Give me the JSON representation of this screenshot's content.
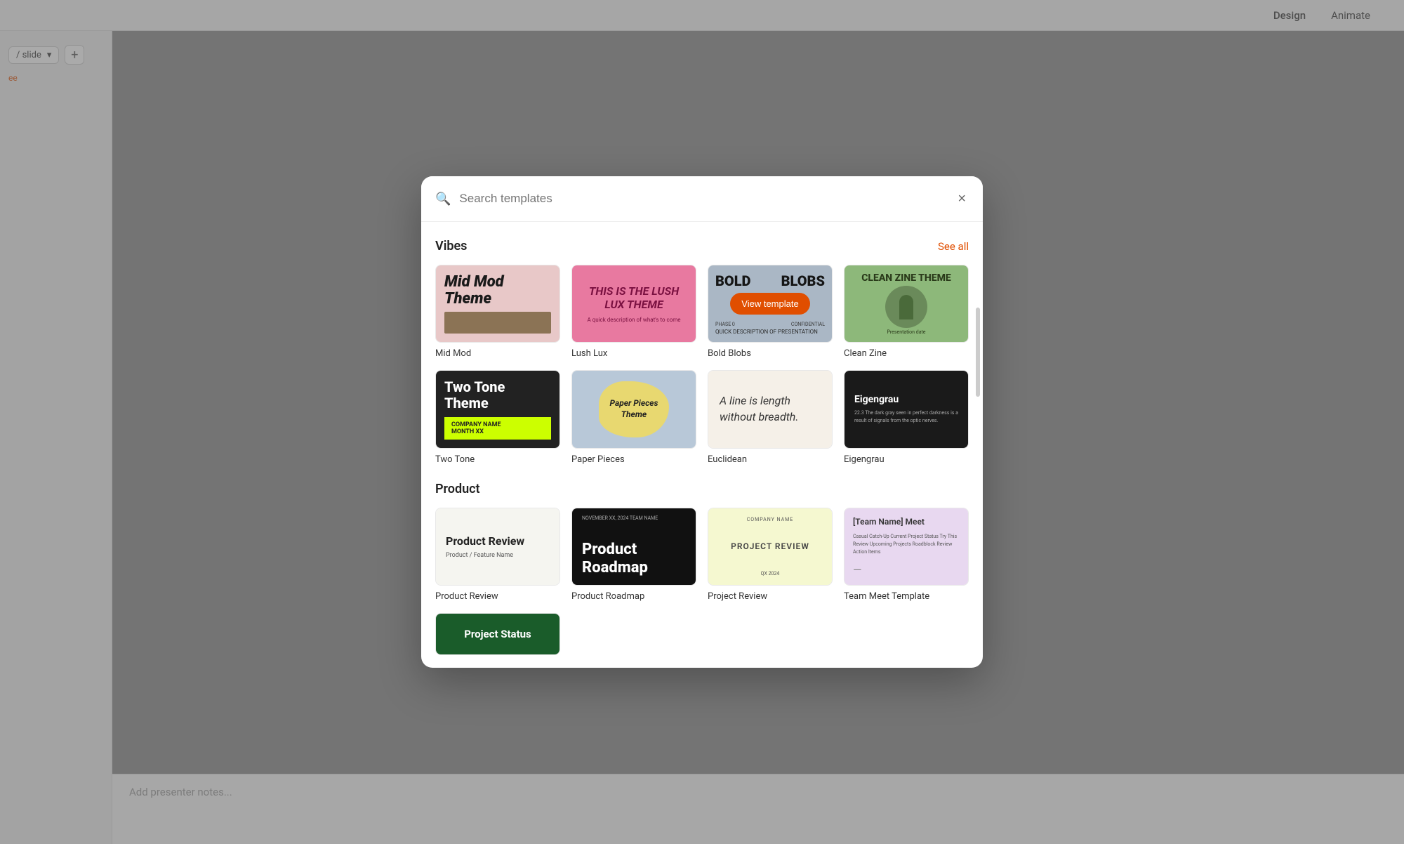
{
  "appBar": {
    "tabs": [
      "Design",
      "Animate"
    ],
    "activeTab": "Design"
  },
  "leftSidebar": {
    "slideDropdown": "/ slide",
    "addButton": "+"
  },
  "presenterNotes": {
    "placeholder": "Add presenter notes..."
  },
  "modal": {
    "searchPlaceholder": "Search templates",
    "closeButton": "×",
    "sections": [
      {
        "id": "vibes",
        "title": "Vibes",
        "seeAll": "See all",
        "templates": [
          {
            "id": "midmod",
            "name": "Mid Mod"
          },
          {
            "id": "lushlux",
            "name": "Lush Lux"
          },
          {
            "id": "boldblobs",
            "name": "Bold Blobs",
            "hasViewOverlay": true
          },
          {
            "id": "cleanzine",
            "name": "Clean Zine"
          },
          {
            "id": "twotone",
            "name": "Two Tone"
          },
          {
            "id": "paperpieces",
            "name": "Paper Pieces"
          },
          {
            "id": "euclidean",
            "name": "Euclidean"
          },
          {
            "id": "eigengrau",
            "name": "Eigengrau"
          }
        ]
      },
      {
        "id": "product",
        "title": "Product",
        "seeAll": null,
        "templates": [
          {
            "id": "productreview",
            "name": "Product Review"
          },
          {
            "id": "productroadmap",
            "name": "Product Roadmap"
          },
          {
            "id": "projectreview",
            "name": "Project Review"
          },
          {
            "id": "teammeet",
            "name": "Team Meet Template"
          }
        ]
      }
    ],
    "viewTemplateLabel": "View template",
    "thumbContent": {
      "midmod": {
        "title": "Mid Mod Theme"
      },
      "lushlux": {
        "title": "THIS IS THE LUSH LUX THEME",
        "sub": "A quick description of what's to come"
      },
      "boldblobs": {
        "left": "BOLD",
        "right": "BLOBS",
        "sub": "QUICK DESCRIPTION OF PRESENTATION",
        "phase": "PHASE 0",
        "confidential": "CONFIDENTIAL"
      },
      "cleanzine": {
        "title": "CLEAN ZINE THEME",
        "date": "Presentation date"
      },
      "twotone": {
        "title": "Two Tone Theme",
        "company": "COMPANY NAME",
        "month": "MONTH XX"
      },
      "paperpieces": {
        "title": "Paper Pieces Theme"
      },
      "euclidean": {
        "text": "A line is length without breadth."
      },
      "eigengrau": {
        "title": "Eigengrau",
        "text": "22.3 The dark gray seen in perfect darkness is a result of signals from the optic nerves."
      },
      "productreview": {
        "title": "Product Review",
        "sub": "Product / Feature Name"
      },
      "productroadmap": {
        "meta": "NOVEMBER XX, 2024  TEAM NAME",
        "title": "Product Roadmap"
      },
      "projectreview": {
        "company": "COMPANY NAME",
        "title": "PROJECT REVIEW",
        "qx": "QX 2024"
      },
      "teammeet": {
        "title": "[Team Name] Meet",
        "items": "Casual Catch-Up\nCurrent Project Status\nTry This Review\nUpcoming Projects\nRoadblock Review\nAction Items",
        "dash": "—"
      },
      "projectstatus": {
        "title": "Project Status"
      }
    }
  }
}
